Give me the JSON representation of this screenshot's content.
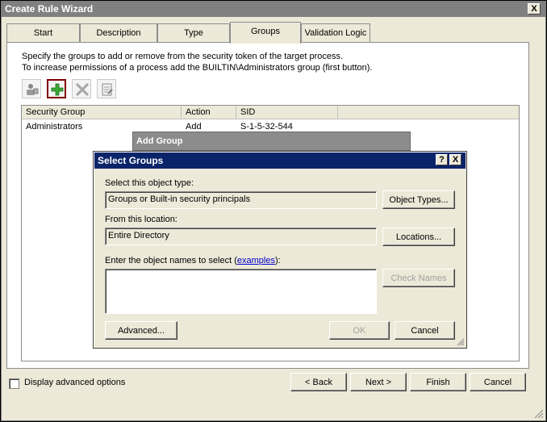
{
  "window": {
    "title": "Create Rule Wizard",
    "close_label": "X"
  },
  "tabs": [
    {
      "label": "Start"
    },
    {
      "label": "Description"
    },
    {
      "label": "Type"
    },
    {
      "label": "Groups",
      "active": true
    },
    {
      "label": "Validation Logic"
    }
  ],
  "groups_tab": {
    "instructions": [
      "Specify the groups to add or remove from the security token of the target process.",
      "To increase permissions of a process add the BUILTIN\\Administrators group (first button)."
    ],
    "toolbar": [
      {
        "icon": "user-group-icon"
      },
      {
        "icon": "add-plus-icon",
        "selected": true
      },
      {
        "icon": "delete-x-icon"
      },
      {
        "icon": "edit-properties-icon"
      }
    ],
    "columns": [
      "Security Group",
      "Action",
      "SID"
    ],
    "rows": [
      {
        "group": "Administrators",
        "action": "Add",
        "sid": "S-1-5-32-544"
      }
    ]
  },
  "add_group_dialog": {
    "title": "Add Group"
  },
  "select_groups_dialog": {
    "title": "Select Groups",
    "help_label": "?",
    "close_label": "X",
    "object_type_label": "Select this object type:",
    "object_type_value": "Groups or Built-in security principals",
    "object_types_button": "Object Types...",
    "location_label": "From this location:",
    "location_value": "Entire Directory",
    "locations_button": "Locations...",
    "names_label_prefix": "Enter the object names to select (",
    "names_label_link": "examples",
    "names_label_suffix": "):",
    "names_value": "",
    "check_names_button": "Check Names",
    "advanced_button": "Advanced...",
    "ok_button": "OK",
    "cancel_button": "Cancel"
  },
  "footer": {
    "advanced_options_label": "Display advanced options",
    "back_button": "< Back",
    "next_button": "Next >",
    "finish_button": "Finish",
    "cancel_button": "Cancel"
  },
  "colors": {
    "dialog_face": "#ece9d8",
    "active_titlebar": "#0a246a",
    "inactive_titlebar": "#808080",
    "selected_button_border": "#800000",
    "link": "#0000cc"
  }
}
